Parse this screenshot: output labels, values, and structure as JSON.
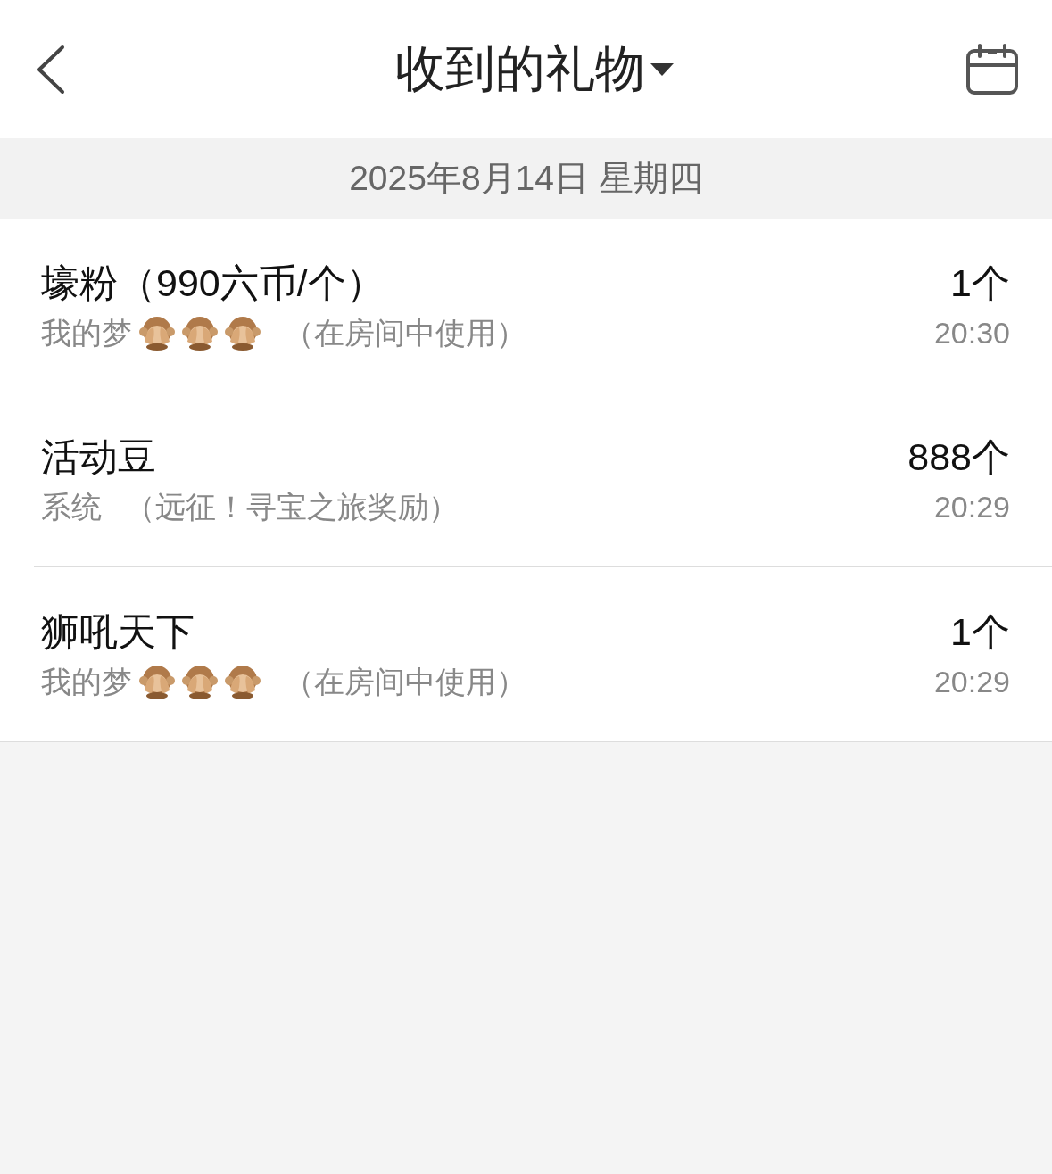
{
  "header": {
    "title": "收到的礼物"
  },
  "date_bar": {
    "text": "2025年8月14日 星期四"
  },
  "gifts": [
    {
      "name": "壕粉（990六币/个）",
      "sender": "我的梦",
      "badges": [
        {
          "kind": "monkey"
        },
        {
          "kind": "monkey"
        },
        {
          "kind": "monkey"
        }
      ],
      "note": "（在房间中使用）",
      "count": "1个",
      "time": "20:30"
    },
    {
      "name": "活动豆",
      "sender": "系统",
      "note": "（远征！寻宝之旅奖励）",
      "count": "888个",
      "time": "20:29"
    },
    {
      "name": "狮吼天下",
      "sender": "我的梦",
      "badges": [
        {
          "kind": "monkey"
        },
        {
          "kind": "monkey"
        },
        {
          "kind": "monkey"
        }
      ],
      "note": "（在房间中使用）",
      "count": "1个",
      "time": "20:29"
    }
  ]
}
